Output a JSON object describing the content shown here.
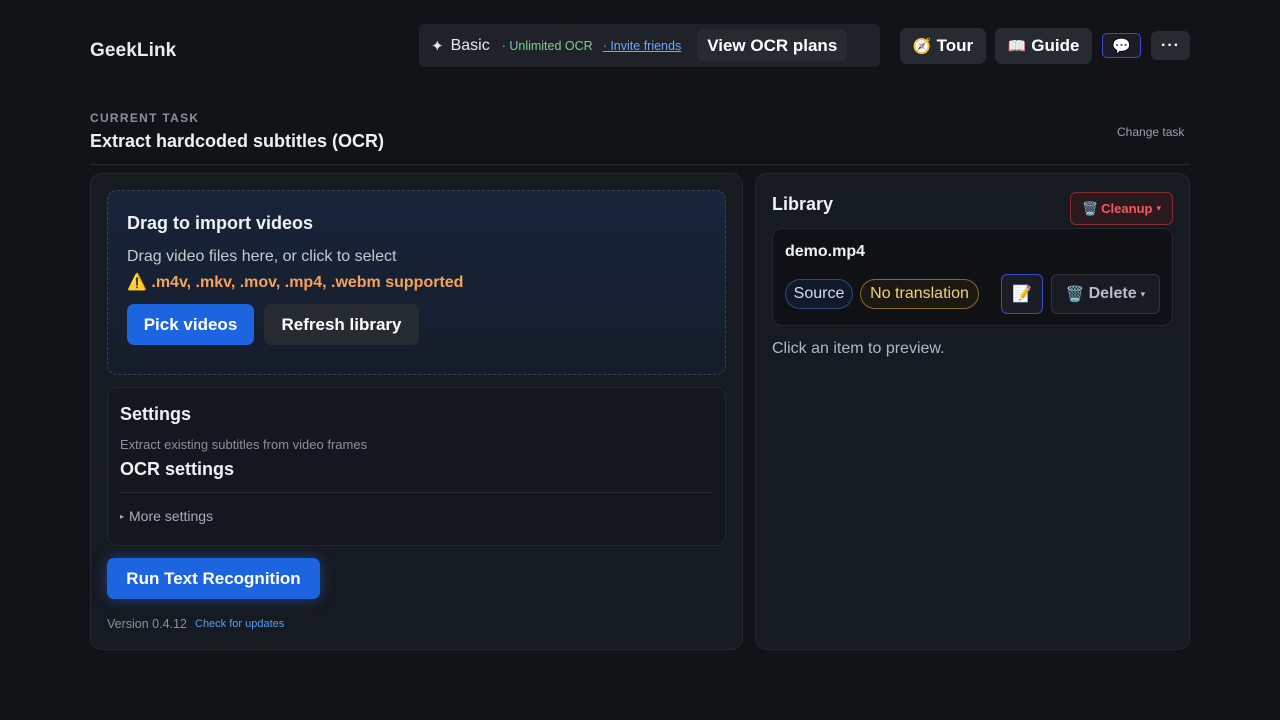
{
  "header": {
    "brand": "GeekLink",
    "plan": {
      "spark_icon": "sparkle-icon",
      "name": "Basic",
      "unlimited": "· Unlimited OCR",
      "invite": "· Invite friends",
      "view_plans": "View OCR plans"
    },
    "tour": {
      "icon": "🧭",
      "label": "Tour"
    },
    "guide": {
      "icon": "📖",
      "label": "Guide"
    },
    "chat_icon": "💬",
    "more_icon": "···"
  },
  "task": {
    "kicker": "CURRENT TASK",
    "title": "Extract hardcoded subtitles (OCR)",
    "change": "Change task"
  },
  "import": {
    "title": "Drag to import videos",
    "subtitle": "Drag video files here, or click to select",
    "formats": "⚠️ .m4v, .mkv, .mov, .mp4, .webm supported",
    "pick_label": "Pick videos",
    "refresh_label": "Refresh library"
  },
  "settings": {
    "title": "Settings",
    "description": "Extract existing subtitles from video frames",
    "ocr_title": "OCR settings",
    "more_marker": "▸",
    "more_label": "More settings"
  },
  "run_label": "Run Text Recognition",
  "footer": {
    "version": "Version 0.4.12",
    "check_updates": "Check for updates"
  },
  "library": {
    "title": "Library",
    "cleanup": {
      "icon": "🗑️",
      "label": "Cleanup",
      "caret": "▾"
    },
    "items": [
      {
        "name": "demo.mp4",
        "tag_source": "Source",
        "tag_translation": "No translation",
        "edit_icon": "📝",
        "delete": {
          "icon": "🗑️",
          "label": "Delete",
          "caret": "▾"
        }
      }
    ],
    "preview_hint": "Click an item to preview."
  }
}
